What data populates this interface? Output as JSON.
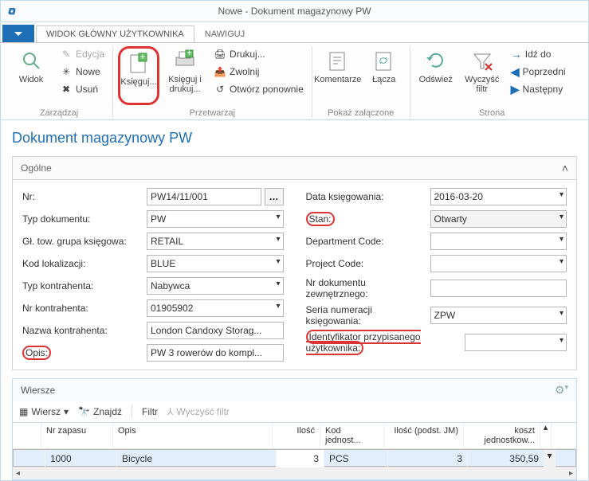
{
  "window": {
    "title": "Nowe - Dokument magazynowy PW"
  },
  "tabs": {
    "main": "WIDOK GŁÓWNY UŻYTKOWNIKA",
    "nav": "NAWIGUJ"
  },
  "ribbon": {
    "manage": {
      "widok": "Widok",
      "edycja": "Edycja",
      "nowe": "Nowe",
      "usun": "Usuń",
      "group": "Zarządzaj"
    },
    "process": {
      "ksieguj": "Księguj...",
      "ksieguj_drukuj": "Księguj i\ndrukuj...",
      "drukuj": "Drukuj...",
      "zwolnij": "Zwolnij",
      "otworz": "Otwórz ponownie",
      "group": "Przetwarzaj"
    },
    "attach": {
      "komentarze": "Komentarze",
      "lacza": "Łącza",
      "group": "Pokaż załączone"
    },
    "page": {
      "odswiez": "Odśwież",
      "wyczysc": "Wyczyść\nfiltr",
      "idz": "Idź do",
      "poprzedni": "Poprzedni",
      "nastepny": "Następny",
      "group": "Strona"
    }
  },
  "page_title": "Dokument magazynowy PW",
  "general_caption": "Ogólne",
  "fields_left": {
    "nr": {
      "label": "Nr:",
      "value": "PW14/11/001"
    },
    "typ_dok": {
      "label": "Typ dokumentu:",
      "value": "PW"
    },
    "grupa": {
      "label": "Gł. tow. grupa księgowa:",
      "value": "RETAIL"
    },
    "lokal": {
      "label": "Kod lokalizacji:",
      "value": "BLUE"
    },
    "typ_kontr": {
      "label": "Typ kontrahenta:",
      "value": "Nabywca"
    },
    "nr_kontr": {
      "label": "Nr kontrahenta:",
      "value": "01905902"
    },
    "nazwa_kontr": {
      "label": "Nazwa kontrahenta:",
      "value": "London Candoxy Storag..."
    },
    "opis": {
      "label": "Opis:",
      "value": "PW 3 rowerów do kompl..."
    }
  },
  "fields_right": {
    "data": {
      "label": "Data księgowania:",
      "value": "2016-03-20"
    },
    "stan": {
      "label": "Stan:",
      "value": "Otwarty"
    },
    "dept": {
      "label": "Department Code:",
      "value": ""
    },
    "proj": {
      "label": "Project Code:",
      "value": ""
    },
    "nr_ext": {
      "label": "Nr dokumentu zewnętrznego:",
      "value": ""
    },
    "seria": {
      "label": "Seria numeracji księgowania:",
      "value": "ZPW"
    },
    "ident": {
      "label": "Identyfikator przypisanego użytkownika:",
      "value": ""
    }
  },
  "lines": {
    "caption": "Wiersze",
    "toolbar": {
      "wiersz": "Wiersz",
      "znajdz": "Znajdź",
      "filtr": "Filtr",
      "wyczysc": "Wyczyść filtr"
    },
    "columns": {
      "nr_zapasu": "Nr zapasu",
      "opis": "Opis",
      "ilosc": "Ilość",
      "kod_jm": "Kod jednost...",
      "ilosc_podst": "Ilość (podst. JM)",
      "koszt": "koszt jednostkow..."
    },
    "rows": [
      {
        "nr_zapasu": "1000",
        "opis": "Bicycle",
        "ilosc": "3",
        "kod_jm": "PCS",
        "ilosc_podst": "3",
        "koszt": "350,59"
      }
    ]
  }
}
